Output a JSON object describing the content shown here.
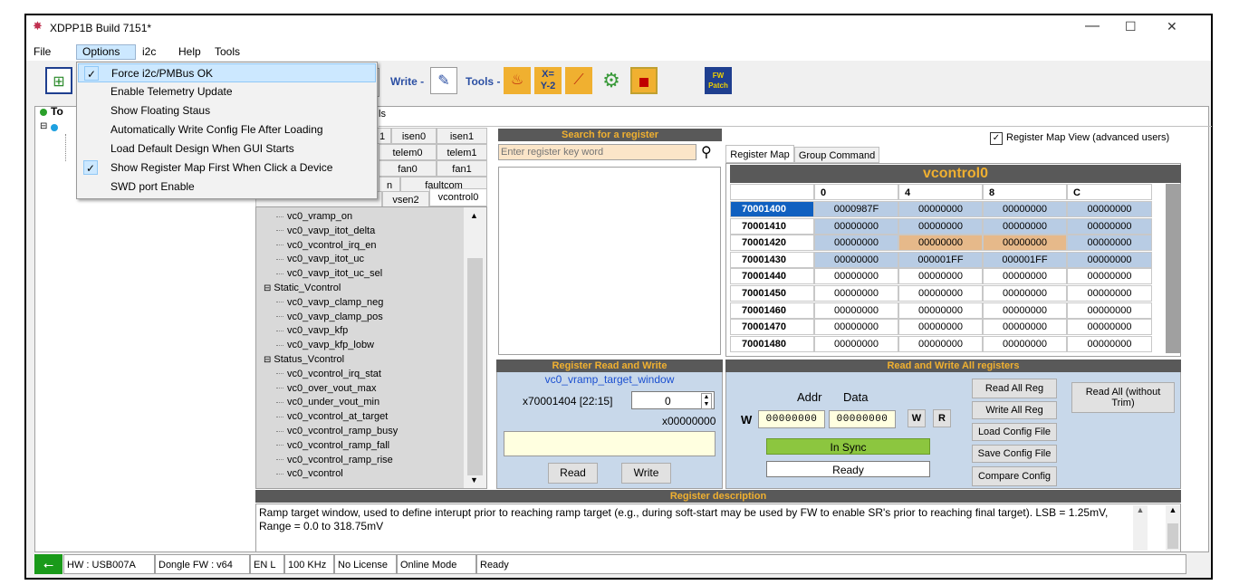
{
  "window": {
    "title": "XDPP1B Build 7151*",
    "minimize": "—",
    "maximize": "☐",
    "close": "✕"
  },
  "menu": [
    "File",
    "Options",
    "i2c",
    "Help",
    "Tools"
  ],
  "options_menu": {
    "items": [
      {
        "label": "Force i2c/PMBus OK",
        "checked": true,
        "check": "✓"
      },
      {
        "label": "Enable Telemetry Update",
        "checked": false
      },
      {
        "label": "Show Floating Staus",
        "checked": false
      },
      {
        "label": "Automatically Write Config Fle After Loading",
        "checked": false
      },
      {
        "label": "Load Default Design When GUI Starts",
        "checked": false
      },
      {
        "label": "Show Register Map First  When Click a Device",
        "checked": true,
        "check": "✓"
      },
      {
        "label": "SWD port Enable",
        "checked": false
      }
    ]
  },
  "toolbar": {
    "write_label": "Write -",
    "tools_label": "Tools -",
    "fw_patch_label": "FW\nPatch",
    "fw_line1": "FW",
    "fw_line2": "Patch"
  },
  "tree": {
    "root_label": "To"
  },
  "partial_tab_label": "ls",
  "param_tabs": {
    "row1": [
      "1",
      "isen0",
      "isen1"
    ],
    "row2": [
      "",
      "telem0",
      "telem1"
    ],
    "row3": [
      "",
      "fan0",
      "fan1"
    ],
    "row4": [
      "n",
      "faultcom"
    ],
    "row5": [
      "vsen2",
      "vcontrol0"
    ]
  },
  "register_tree": [
    {
      "label": "vc0_vramp_on",
      "level": 2
    },
    {
      "label": "vc0_vavp_itot_delta",
      "level": 2
    },
    {
      "label": "vc0_vcontrol_irq_en",
      "level": 2
    },
    {
      "label": "vc0_vavp_itot_uc",
      "level": 2
    },
    {
      "label": "vc0_vavp_itot_uc_sel",
      "level": 2
    },
    {
      "label": "Static_Vcontrol",
      "level": 1,
      "toggle": "⊟"
    },
    {
      "label": "vc0_vavp_clamp_neg",
      "level": 2
    },
    {
      "label": "vc0_vavp_clamp_pos",
      "level": 2
    },
    {
      "label": "vc0_vavp_kfp",
      "level": 2
    },
    {
      "label": "vc0_vavp_kfp_lobw",
      "level": 2
    },
    {
      "label": "Status_Vcontrol",
      "level": 1,
      "toggle": "⊟"
    },
    {
      "label": "vc0_vcontrol_irq_stat",
      "level": 2
    },
    {
      "label": "vc0_over_vout_max",
      "level": 2
    },
    {
      "label": "vc0_under_vout_min",
      "level": 2
    },
    {
      "label": "vc0_vcontrol_at_target",
      "level": 2
    },
    {
      "label": "vc0_vcontrol_ramp_busy",
      "level": 2
    },
    {
      "label": "vc0_vcontrol_ramp_fall",
      "level": 2
    },
    {
      "label": "vc0_vcontrol_ramp_rise",
      "level": 2
    },
    {
      "label": "vc0_vcontrol",
      "level": 2
    }
  ],
  "search": {
    "header": "Search for a register",
    "placeholder": "Enter register key word"
  },
  "register_map": {
    "checkbox_label": "Register Map View (advanced users)",
    "checked": true,
    "tabs": [
      "Register Map",
      "Group Command"
    ],
    "title": "vcontrol0",
    "columns": [
      "0",
      "4",
      "8",
      "C"
    ],
    "rows": [
      {
        "addr": "70001400",
        "values": [
          "0000987F",
          "00000000",
          "00000000",
          "00000000"
        ],
        "selected": true,
        "colors": [
          "blue",
          "blue",
          "blue",
          "blue"
        ]
      },
      {
        "addr": "70001410",
        "values": [
          "00000000",
          "00000000",
          "00000000",
          "00000000"
        ],
        "colors": [
          "blue",
          "blue",
          "blue",
          "blue"
        ]
      },
      {
        "addr": "70001420",
        "values": [
          "00000000",
          "00000000",
          "00000000",
          "00000000"
        ],
        "colors": [
          "blue",
          "tan",
          "tan",
          "blue"
        ]
      },
      {
        "addr": "70001430",
        "values": [
          "00000000",
          "000001FF",
          "000001FF",
          "00000000"
        ],
        "colors": [
          "blue",
          "blue",
          "blue",
          "blue"
        ]
      },
      {
        "addr": "70001440",
        "values": [
          "00000000",
          "00000000",
          "00000000",
          "00000000"
        ],
        "colors": [
          "white",
          "white",
          "white",
          "white"
        ]
      },
      {
        "addr": "70001450",
        "values": [
          "00000000",
          "00000000",
          "00000000",
          "00000000"
        ],
        "colors": [
          "white",
          "white",
          "white",
          "white"
        ]
      },
      {
        "addr": "70001460",
        "values": [
          "00000000",
          "00000000",
          "00000000",
          "00000000"
        ],
        "colors": [
          "white",
          "white",
          "white",
          "white"
        ]
      },
      {
        "addr": "70001470",
        "values": [
          "00000000",
          "00000000",
          "00000000",
          "00000000"
        ],
        "colors": [
          "white",
          "white",
          "white",
          "white"
        ]
      },
      {
        "addr": "70001480",
        "values": [
          "00000000",
          "00000000",
          "00000000",
          "00000000"
        ],
        "colors": [
          "white",
          "white",
          "white",
          "white"
        ]
      }
    ]
  },
  "rw_panel": {
    "header": "Register Read and Write",
    "reg_name": "vc0_vramp_target_window",
    "bit_label": "x70001404 [22:15]",
    "value": "0",
    "hex": "x00000000",
    "read": "Read",
    "write": "Write"
  },
  "rw_all": {
    "header": "Read and Write All registers",
    "addr_label": "Addr",
    "data_label": "Data",
    "w_label": "W",
    "addr_value": "00000000",
    "data_value": "00000000",
    "w_btn": "W",
    "r_btn": "R",
    "sync_status": "In Sync",
    "ready_status": "Ready",
    "buttons": [
      "Read All Reg",
      "Write All Reg",
      "Load Config File",
      "Save Config File",
      "Compare Config"
    ],
    "read_all_no_trim": "Read All (without Trim)"
  },
  "description": {
    "header": "Register description",
    "text": "Ramp target window, used to define interupt prior to reaching ramp target (e.g., during soft-start may be used by FW to enable SR's prior to reaching final target). LSB = 1.25mV, Range = 0.0 to 318.75mV"
  },
  "status_bar": [
    "HW : USB007A",
    "Dongle FW : v64",
    "EN L",
    "100 KHz",
    "No License",
    "Online Mode",
    "Ready"
  ],
  "colors": {
    "header_bg": "#595959",
    "header_text": "#f0b030",
    "selected_addr": "#1060c0",
    "modified_cell": "#e6b98a",
    "in_sync": "#8cc63f"
  }
}
